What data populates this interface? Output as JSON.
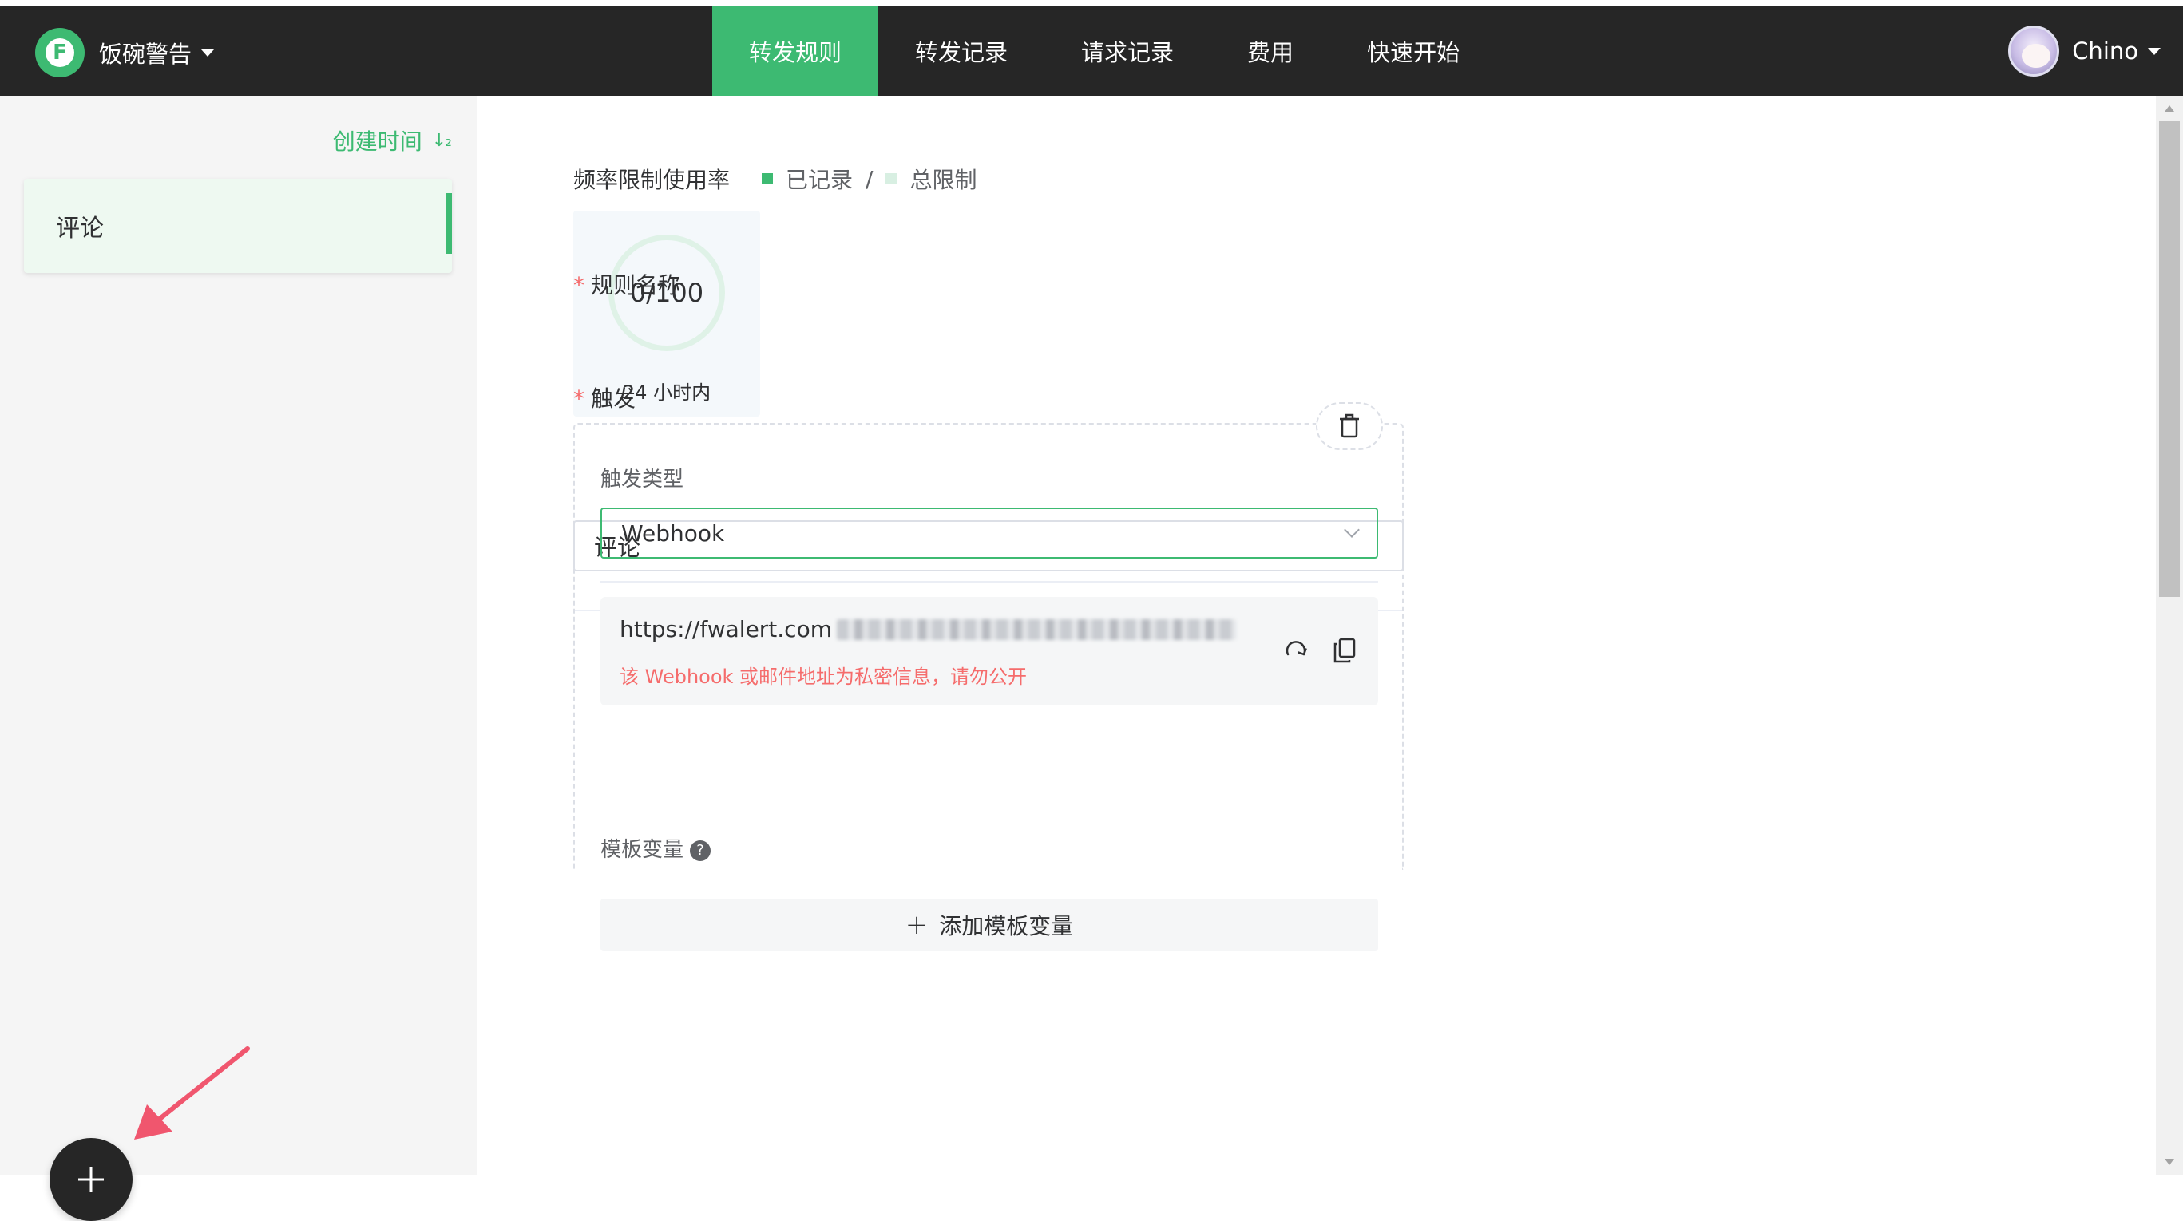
{
  "header": {
    "brand_letter": "F",
    "brand_name": "饭碗警告",
    "nav": [
      {
        "label": "转发规则",
        "active": true
      },
      {
        "label": "转发记录",
        "active": false
      },
      {
        "label": "请求记录",
        "active": false
      },
      {
        "label": "费用",
        "active": false
      },
      {
        "label": "快速开始",
        "active": false
      }
    ],
    "user_name": "Chino"
  },
  "sidebar": {
    "sort_label": "创建时间",
    "sort_icon": "sort-ascending-icon",
    "rules": [
      {
        "label": "评论",
        "selected": true
      }
    ],
    "add_icon": "plus-icon"
  },
  "usage": {
    "title": "频率限制使用率",
    "legend_recorded": "已记录",
    "legend_separator": "/",
    "legend_total": "总限制",
    "value": "0/100",
    "used": 0,
    "limit": 100,
    "period": "24 小时内",
    "colors": {
      "recorded": "#3dba72",
      "total": "#d8efe2"
    }
  },
  "form": {
    "rule_name_label": "规则名称",
    "rule_name_value": "评论",
    "trigger_label": "触发",
    "required_mark": "*",
    "trigger": {
      "type_label": "触发类型",
      "type_value": "Webhook",
      "webhook_url_prefix": "https://fwalert.com",
      "webhook_warning": "该 Webhook 或邮件地址为私密信息，请勿公开",
      "template_vars_label": "模板变量",
      "help_glyph": "?",
      "add_template_var": "添加模板变量"
    }
  },
  "theme": {
    "accent": "#3dba72",
    "dark": "#262626",
    "danger": "#f56c6c"
  }
}
